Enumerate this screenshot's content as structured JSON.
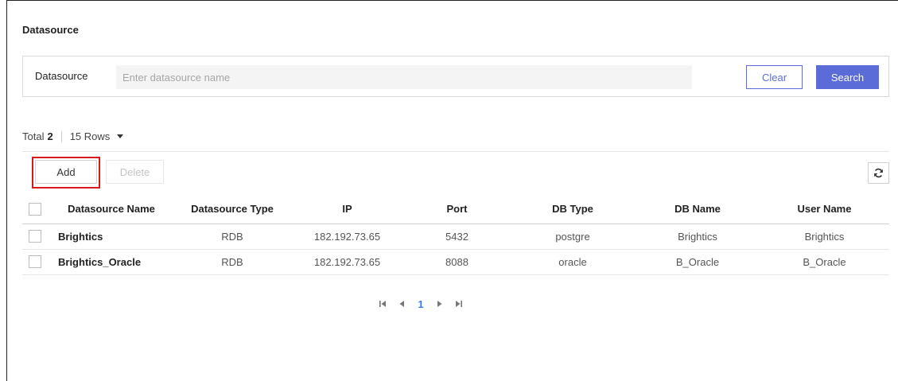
{
  "page": {
    "title": "Datasource"
  },
  "search": {
    "label": "Datasource",
    "placeholder": "Enter datasource name",
    "value": "",
    "clear_label": "Clear",
    "search_label": "Search"
  },
  "summary": {
    "total_label": "Total",
    "total_count": "2",
    "rows_label": "15 Rows"
  },
  "toolbar": {
    "add_label": "Add",
    "delete_label": "Delete",
    "refresh_icon": "refresh-icon"
  },
  "table": {
    "headers": [
      "Datasource Name",
      "Datasource Type",
      "IP",
      "Port",
      "DB Type",
      "DB Name",
      "User Name"
    ],
    "rows": [
      [
        "Brightics",
        "RDB",
        "182.192.73.65",
        "5432",
        "postgre",
        "Brightics",
        "Brightics"
      ],
      [
        "Brightics_Oracle",
        "RDB",
        "182.192.73.65",
        "8088",
        "oracle",
        "B_Oracle",
        "B_Oracle"
      ]
    ]
  },
  "pagination": {
    "first": "⏮",
    "prev": "◀",
    "current_page": "1",
    "next": "▶",
    "last": "⏭"
  },
  "colors": {
    "accent": "#5b6cd8",
    "highlight": "#d7191c",
    "current_page": "#3b7de0"
  }
}
